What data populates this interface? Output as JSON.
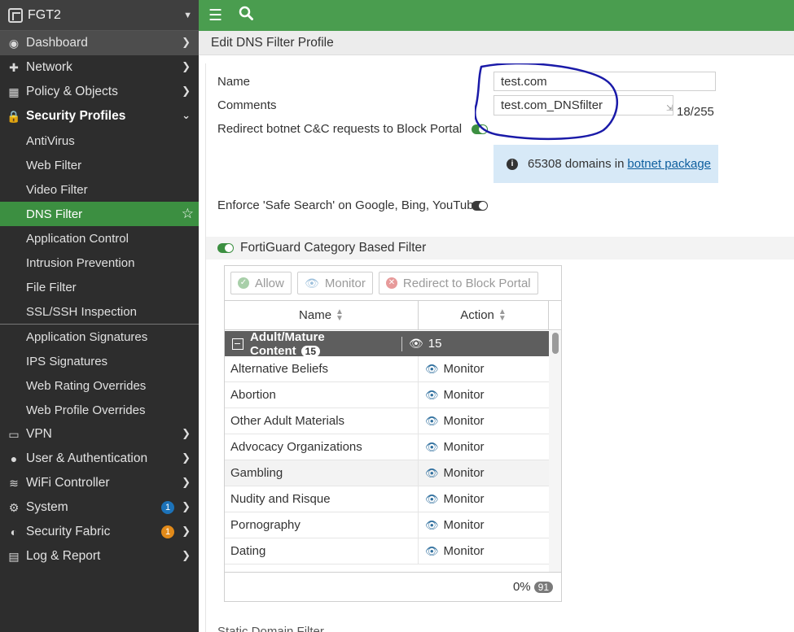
{
  "header": {
    "device_name": "FGT2"
  },
  "sidebar": {
    "items": [
      {
        "label": "Dashboard"
      },
      {
        "label": "Network"
      },
      {
        "label": "Policy & Objects"
      },
      {
        "label": "Security Profiles"
      }
    ],
    "security_sub": [
      "AntiVirus",
      "Web Filter",
      "Video Filter",
      "DNS Filter",
      "Application Control",
      "Intrusion Prevention",
      "File Filter",
      "SSL/SSH Inspection"
    ],
    "security_sub2": [
      "Application Signatures",
      "IPS Signatures",
      "Web Rating Overrides",
      "Web Profile Overrides"
    ],
    "bottom_items": [
      {
        "label": "VPN"
      },
      {
        "label": "User & Authentication"
      },
      {
        "label": "WiFi Controller"
      },
      {
        "label": "System",
        "badge": "1"
      },
      {
        "label": "Security Fabric",
        "badge": "1"
      },
      {
        "label": "Log & Report"
      }
    ]
  },
  "page": {
    "title": "Edit DNS Filter Profile"
  },
  "form": {
    "name_label": "Name",
    "name_value": "test.com",
    "comments_label": "Comments",
    "comments_value": "test.com_DNSfilter",
    "comments_counter": "18/255",
    "redirect_label": "Redirect botnet C&C requests to Block Portal",
    "botnet_text": "65308 domains in",
    "botnet_link": "botnet package",
    "safe_search_label": "Enforce 'Safe Search' on Google, Bing, YouTube"
  },
  "fortiguard": {
    "section_title": "FortiGuard Category Based Filter",
    "toolbar": {
      "allow": "Allow",
      "monitor": "Monitor",
      "redirect": "Redirect to Block Portal"
    },
    "columns": {
      "name": "Name",
      "action": "Action"
    },
    "group": {
      "name": "Adult/Mature Content",
      "count": "15",
      "monitor_count": "15"
    },
    "rows": [
      {
        "name": "Alternative Beliefs",
        "action": "Monitor"
      },
      {
        "name": "Abortion",
        "action": "Monitor"
      },
      {
        "name": "Other Adult Materials",
        "action": "Monitor"
      },
      {
        "name": "Advocacy Organizations",
        "action": "Monitor"
      },
      {
        "name": "Gambling",
        "action": "Monitor"
      },
      {
        "name": "Nudity and Risque",
        "action": "Monitor"
      },
      {
        "name": "Pornography",
        "action": "Monitor"
      },
      {
        "name": "Dating",
        "action": "Monitor"
      }
    ],
    "footer": {
      "percent": "0%",
      "total": "91"
    }
  },
  "static_domain_label": "Static Domain Filter",
  "colors": {
    "accent": "#4a9d4f",
    "sidebar": "#2d2d2d",
    "active": "#3c8f41",
    "annotation": "#1a1aa8"
  }
}
